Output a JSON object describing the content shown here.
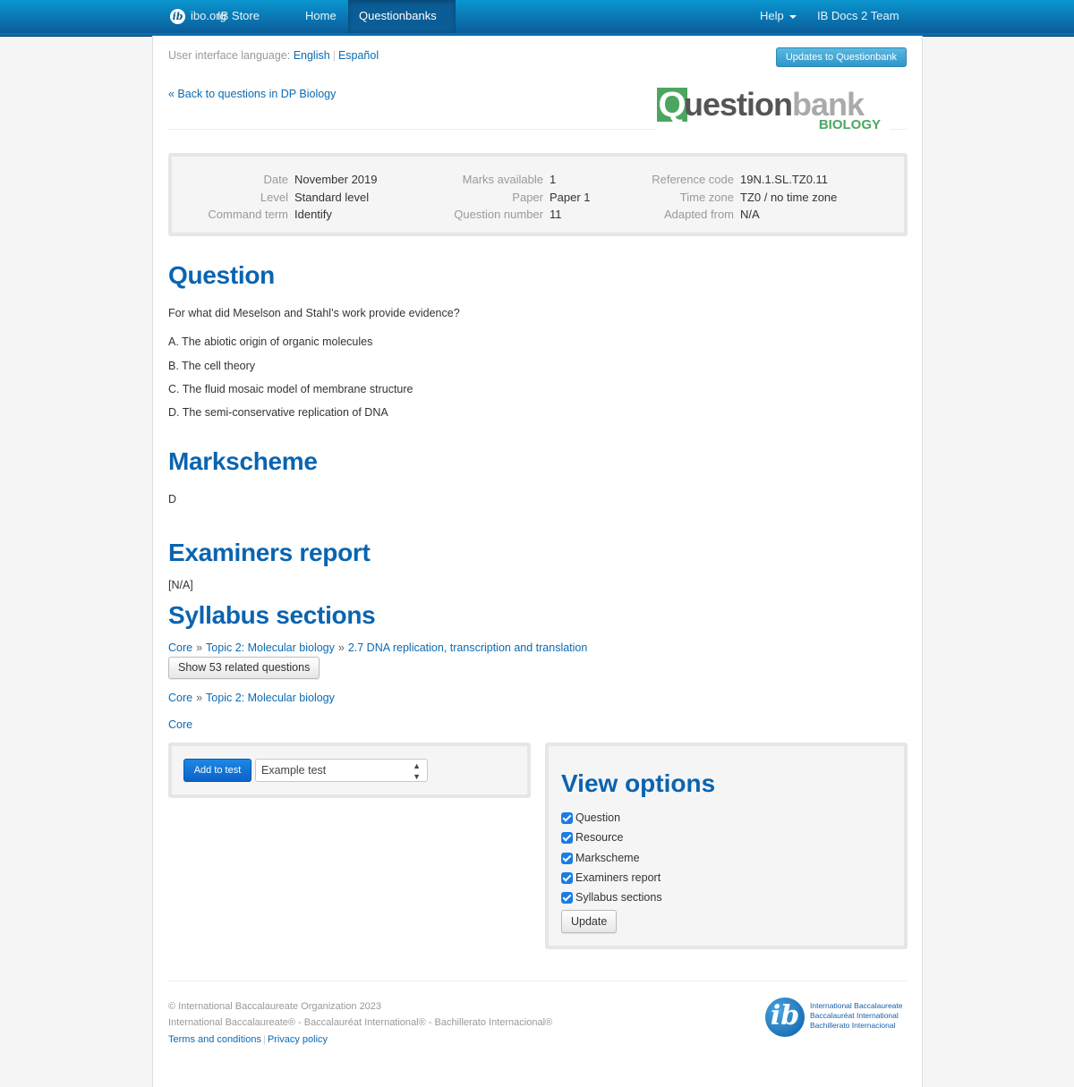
{
  "navbar": {
    "brand": "ibo.org",
    "items": [
      {
        "label": "IB Store"
      },
      {
        "label": "Home"
      },
      {
        "label": "Questionbanks",
        "active": true,
        "dropdown": true
      }
    ],
    "right_items": [
      {
        "label": "Help",
        "dropdown": true
      },
      {
        "label": "IB Docs 2 Team"
      }
    ]
  },
  "language": {
    "label": "User interface language:",
    "options": [
      "English",
      "Español"
    ]
  },
  "updates_button": "Updates to Questionbank",
  "back_link": "« Back to questions in DP Biology",
  "logo": {
    "q": "Q",
    "dark_text": "uestion",
    "light_text": "bank",
    "subject": "BIOLOGY"
  },
  "meta": {
    "col1": [
      {
        "label": "Date",
        "value": "November 2019"
      },
      {
        "label": "Level",
        "value": "Standard level"
      },
      {
        "label": "Command term",
        "value": "Identify"
      }
    ],
    "col2": [
      {
        "label": "Marks available",
        "value": "1"
      },
      {
        "label": "Paper",
        "value": "Paper 1"
      },
      {
        "label": "Question number",
        "value": "11"
      }
    ],
    "col3": [
      {
        "label": "Reference code",
        "value": "19N.1.SL.TZ0.11"
      },
      {
        "label": "Time zone",
        "value": "TZ0 / no time zone"
      },
      {
        "label": "Adapted from",
        "value": "N/A"
      }
    ]
  },
  "question": {
    "heading": "Question",
    "stem": "For what did Meselson and Stahl’s work provide evidence?",
    "options": [
      "A. The abiotic origin of organic molecules",
      "B. The cell theory",
      "C. The fluid mosaic model of membrane structure",
      "D. The semi-conservative replication of DNA"
    ]
  },
  "markscheme": {
    "heading": "Markscheme",
    "answer": "D"
  },
  "examiners_report": {
    "heading": "Examiners report",
    "text": "[N/A]"
  },
  "syllabus": {
    "heading": "Syllabus sections",
    "separator": "»",
    "paths": [
      [
        "Core",
        "Topic 2: Molecular biology",
        "2.7 DNA replication, transcription and translation"
      ],
      [
        "Core",
        "Topic 2: Molecular biology"
      ],
      [
        "Core"
      ]
    ],
    "related_button": "Show 53 related questions"
  },
  "add_to_test": {
    "button": "Add to test",
    "selected_test": "Example test"
  },
  "view_options": {
    "heading": "View options",
    "options": [
      {
        "label": "Question",
        "checked": true
      },
      {
        "label": "Resource",
        "checked": true
      },
      {
        "label": "Markscheme",
        "checked": true
      },
      {
        "label": "Examiners report",
        "checked": true
      },
      {
        "label": "Syllabus sections",
        "checked": true
      }
    ],
    "update_button": "Update"
  },
  "footer": {
    "copyright": "© International Baccalaureate Organization 2023",
    "trademark": "International Baccalaureate® - Baccalauréat International® - Bachillerato Internacional®",
    "links": [
      "Terms and conditions",
      "Privacy policy"
    ],
    "logo_lines": [
      "International Baccalaureate",
      "Baccalauréat International",
      "Bachillerato Internacional"
    ]
  },
  "colors": {
    "nav_blue": "#0a5c99",
    "heading_blue": "#0a64b0",
    "link_blue": "#0a6ab2",
    "logo_green": "#4ca660"
  }
}
